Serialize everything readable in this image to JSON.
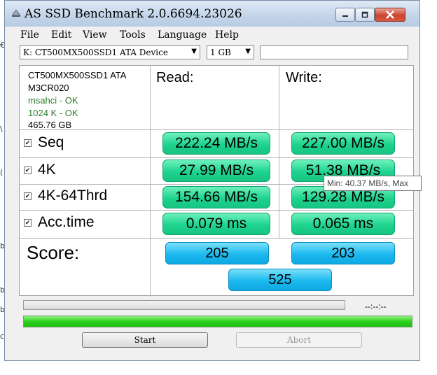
{
  "window": {
    "title": "AS SSD Benchmark 2.0.6694.23026",
    "controls": {
      "minimize": "–",
      "maximize": "□",
      "close": "✕"
    }
  },
  "menu": [
    "File",
    "Edit",
    "View",
    "Tools",
    "Language",
    "Help"
  ],
  "toolbar": {
    "drive": "K: CT500MX500SSD1 ATA Device",
    "size": "1 GB",
    "extra": ""
  },
  "drive_info": {
    "model": "CT500MX500SSD1 ATA",
    "firmware": "M3CR020",
    "msahci": "msahci - OK",
    "alignment": "1024 K - OK",
    "capacity": "465.76 GB"
  },
  "headers": {
    "read": "Read:",
    "write": "Write:"
  },
  "rows": [
    {
      "label": "Seq",
      "checked": true,
      "read": "222.24 MB/s",
      "write": "227.00 MB/s"
    },
    {
      "label": "4K",
      "checked": true,
      "read": "27.99 MB/s",
      "write": "51.38 MB/s"
    },
    {
      "label": "4K-64Thrd",
      "checked": true,
      "read": "154.66 MB/s",
      "write": "129.28 MB/s"
    },
    {
      "label": "Acc.time",
      "checked": true,
      "read": "0.079 ms",
      "write": "0.065 ms"
    }
  ],
  "score": {
    "label": "Score:",
    "read": "205",
    "write": "203",
    "total": "525"
  },
  "tooltip": "Min: 40.37 MB/s, Max",
  "progress": {
    "timer": "--:--:--",
    "top_fraction": 0,
    "bottom_fraction": 1
  },
  "buttons": {
    "start": "Start",
    "abort": "Abort"
  },
  "edge_glyphs": [
    "€",
    "\\",
    "(",
    "b",
    "b",
    "b",
    "c"
  ],
  "colors": {
    "result_green": "#1ed38f",
    "score_blue": "#1bb9ee",
    "info_green": "#2e7d2e",
    "progress_green": "#2cd21c"
  }
}
